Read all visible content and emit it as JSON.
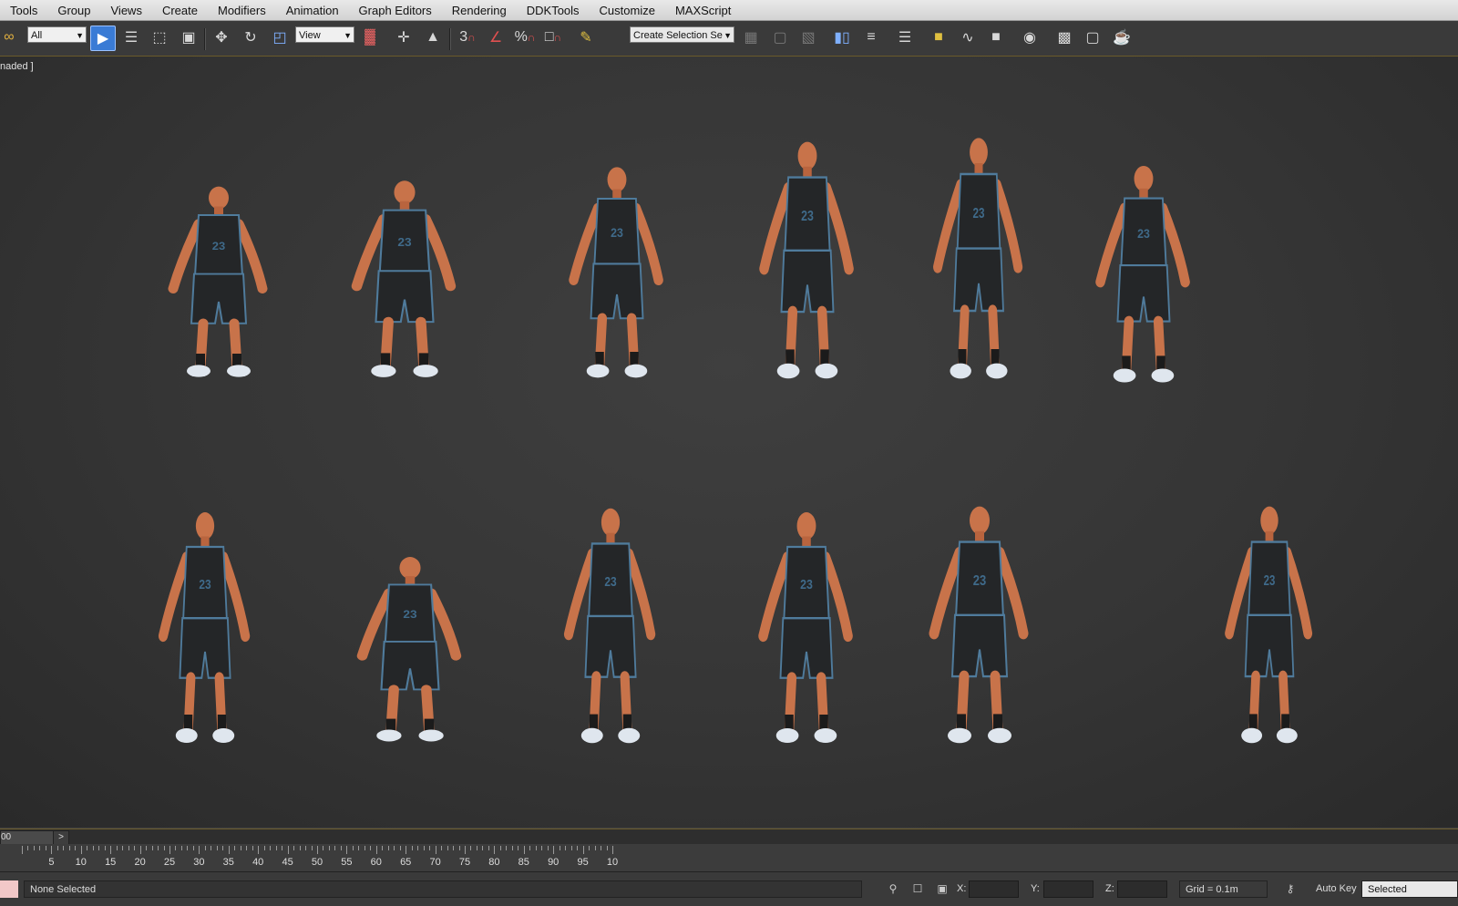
{
  "menu": [
    "Tools",
    "Group",
    "Views",
    "Create",
    "Modifiers",
    "Animation",
    "Graph Editors",
    "Rendering",
    "DDKTools",
    "Customize",
    "MAXScript"
  ],
  "toolbar": {
    "filter_select": "All",
    "ref_coord_select": "View",
    "snap_3": "3",
    "percent_snap": "%",
    "spinner_snap": "□",
    "selection_set": "Create Selection Se"
  },
  "viewport": {
    "label": "naded ]",
    "shading_hint": "shaded",
    "figure_count": 12,
    "jersey_number": "23"
  },
  "timeline": {
    "slider_text": "00",
    "next_button": ">",
    "ticks": [
      "5",
      "10",
      "15",
      "20",
      "25",
      "30",
      "35",
      "40",
      "45",
      "50",
      "55",
      "60",
      "65",
      "70",
      "75",
      "80",
      "85",
      "90",
      "95",
      "10"
    ]
  },
  "status": {
    "selection": "None Selected",
    "x_label": "X:",
    "y_label": "Y:",
    "z_label": "Z:",
    "grid": "Grid = 0.1m",
    "auto_key": "Auto Key",
    "key_filter": "Selected"
  },
  "colors": {
    "skin": "#c8734a",
    "jersey": "#242628",
    "trim": "#4f7b9c",
    "accent": "#f0c040"
  }
}
